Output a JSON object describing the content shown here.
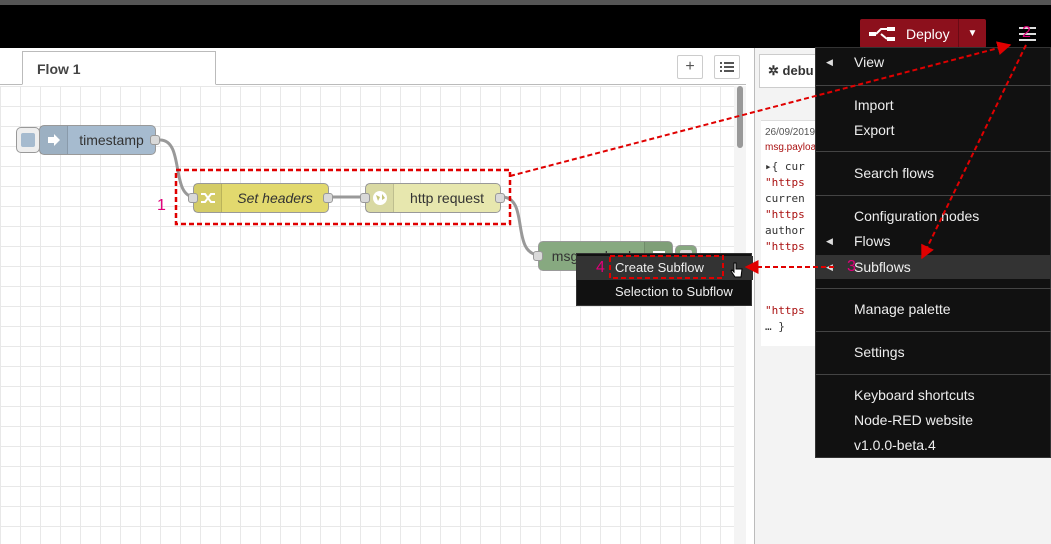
{
  "header": {
    "deploy_label": "Deploy",
    "deploy_color": "#8c101c"
  },
  "workspace": {
    "tabs": [
      {
        "label": "Flow 1"
      }
    ],
    "add_tab_icon": "+",
    "list_tabs_icon": "list-icon"
  },
  "nodes": {
    "timestamp": {
      "label": "timestamp",
      "color": "#a6bbcf",
      "icon": "arrow-right-icon"
    },
    "set_headers": {
      "label": "Set headers",
      "color": "#e2d96e",
      "icon": "shuffle-icon"
    },
    "http_request": {
      "label": "http request",
      "color": "#e7e7ae",
      "icon": "globe-icon"
    },
    "msg_payload": {
      "label": "msg.payload",
      "color": "#87a980",
      "icon": "list-icon"
    }
  },
  "sidebar": {
    "tab_label": "debu",
    "tab_icon": "bug-icon",
    "message": {
      "timestamp": "26/09/2019",
      "topic": "msg.payloa",
      "lines": [
        "▸{ cur",
        "\"https",
        "curren",
        "\"https",
        "author",
        "\"https"
      ],
      "tail": [
        "\"https",
        "… }"
      ]
    }
  },
  "main_menu": {
    "items": [
      {
        "label": "View",
        "has_submenu": true
      },
      {
        "label": "Import"
      },
      {
        "label": "Export"
      },
      {
        "label": "Search flows"
      },
      {
        "label": "Configuration nodes"
      },
      {
        "label": "Flows",
        "has_submenu": true
      },
      {
        "label": "Subflows",
        "has_submenu": true,
        "highlighted": true
      },
      {
        "label": "Manage palette"
      },
      {
        "label": "Settings"
      },
      {
        "label": "Keyboard shortcuts"
      },
      {
        "label": "Node-RED website"
      },
      {
        "label": "v1.0.0-beta.4"
      }
    ]
  },
  "subflows_menu": {
    "items": [
      {
        "label": "Create Subflow",
        "highlighted": true
      },
      {
        "label": "Selection to Subflow"
      }
    ]
  },
  "annotations": {
    "step1": "1",
    "step2": "2",
    "step3": "3",
    "step4": "4",
    "color": "#e0007a",
    "box_color": "#e00000"
  }
}
